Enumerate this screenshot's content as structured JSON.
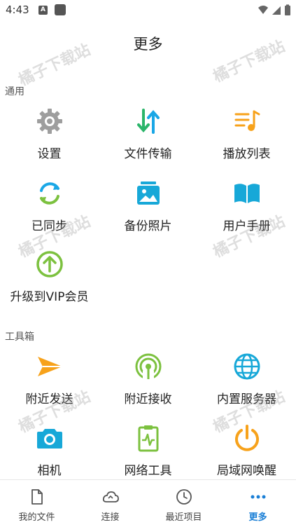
{
  "status_bar": {
    "time": "4:43",
    "notif_icon_letter": "A"
  },
  "header": {
    "title": "更多"
  },
  "sections": {
    "general": {
      "title": "通用",
      "items": [
        {
          "label": "设置",
          "icon": "gear-icon",
          "color": "#9e9e9e"
        },
        {
          "label": "文件传输",
          "icon": "transfer-arrows-icon",
          "color": "#2bb56a"
        },
        {
          "label": "播放列表",
          "icon": "playlist-icon",
          "color": "#f7a21b"
        },
        {
          "label": "已同步",
          "icon": "sync-icon",
          "color": "#1aa7e6"
        },
        {
          "label": "备份照片",
          "icon": "photo-backup-icon",
          "color": "#17a8d8"
        },
        {
          "label": "用户手册",
          "icon": "book-icon",
          "color": "#17a8d8"
        },
        {
          "label": "升级到VIP会员",
          "icon": "upgrade-arrow-icon",
          "color": "#7cc13f"
        }
      ]
    },
    "tools": {
      "title": "工具箱",
      "items": [
        {
          "label": "附近发送",
          "icon": "send-icon",
          "color": "#f7a21b"
        },
        {
          "label": "附近接收",
          "icon": "receive-signal-icon",
          "color": "#7cc13f"
        },
        {
          "label": "内置服务器",
          "icon": "globe-icon",
          "color": "#17a8d8"
        },
        {
          "label": "相机",
          "icon": "camera-icon",
          "color": "#17a8d8"
        },
        {
          "label": "网络工具",
          "icon": "clipboard-pulse-icon",
          "color": "#7cc13f"
        },
        {
          "label": "局域网唤醒",
          "icon": "power-icon",
          "color": "#f7a21b"
        }
      ]
    }
  },
  "bottom_nav": {
    "items": [
      {
        "label": "我的文件",
        "icon": "file-icon",
        "active": false
      },
      {
        "label": "连接",
        "icon": "cloud-icon",
        "active": false
      },
      {
        "label": "最近项目",
        "icon": "clock-icon",
        "active": false
      },
      {
        "label": "更多",
        "icon": "more-dots-icon",
        "active": true
      }
    ],
    "active_color": "#1a7fd6"
  },
  "watermark": {
    "text": "橘子下载站"
  }
}
